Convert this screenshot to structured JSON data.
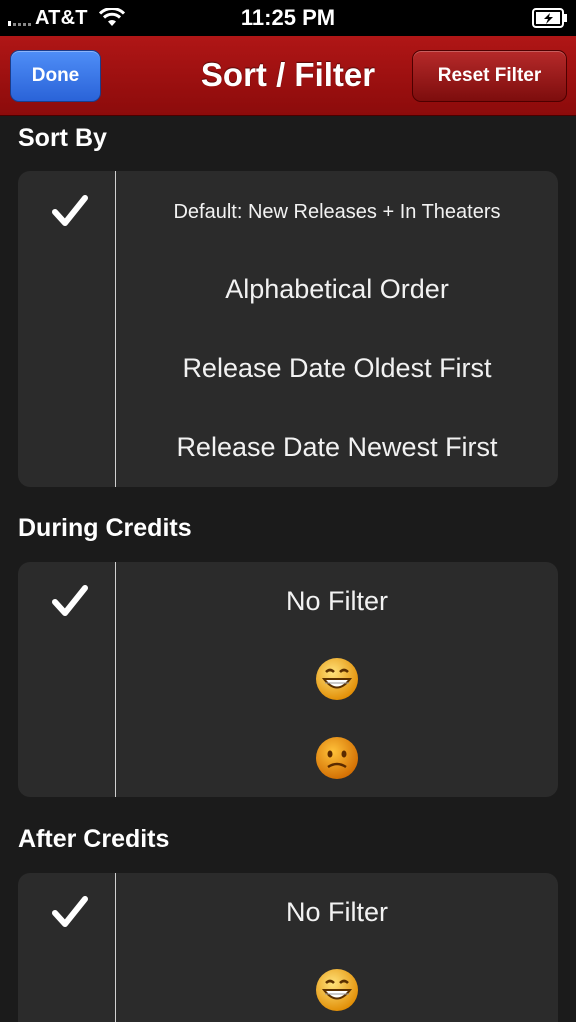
{
  "status_bar": {
    "carrier": "AT&T",
    "time": "11:25 PM"
  },
  "nav": {
    "title": "Sort / Filter",
    "done_label": "Done",
    "reset_label": "Reset Filter"
  },
  "sort_by": {
    "header": "Sort By",
    "options": [
      "Default: New Releases + In Theaters",
      "Alphabetical Order",
      "Release Date Oldest First",
      "Release Date Newest First"
    ],
    "selected_index": 0
  },
  "during_credits": {
    "header": "During Credits",
    "options": [
      {
        "label": "No Filter"
      },
      {
        "icon": "grinning-face-icon"
      },
      {
        "icon": "frowning-face-icon"
      }
    ],
    "selected_index": 0
  },
  "after_credits": {
    "header": "After Credits",
    "options": [
      {
        "label": "No Filter"
      },
      {
        "icon": "grinning-face-icon"
      }
    ],
    "selected_index": 0
  },
  "colors": {
    "nav_red": "#a01010",
    "done_blue": "#3a78e8",
    "background": "#1b1b1b",
    "group_bg": "#2b2b2b"
  }
}
